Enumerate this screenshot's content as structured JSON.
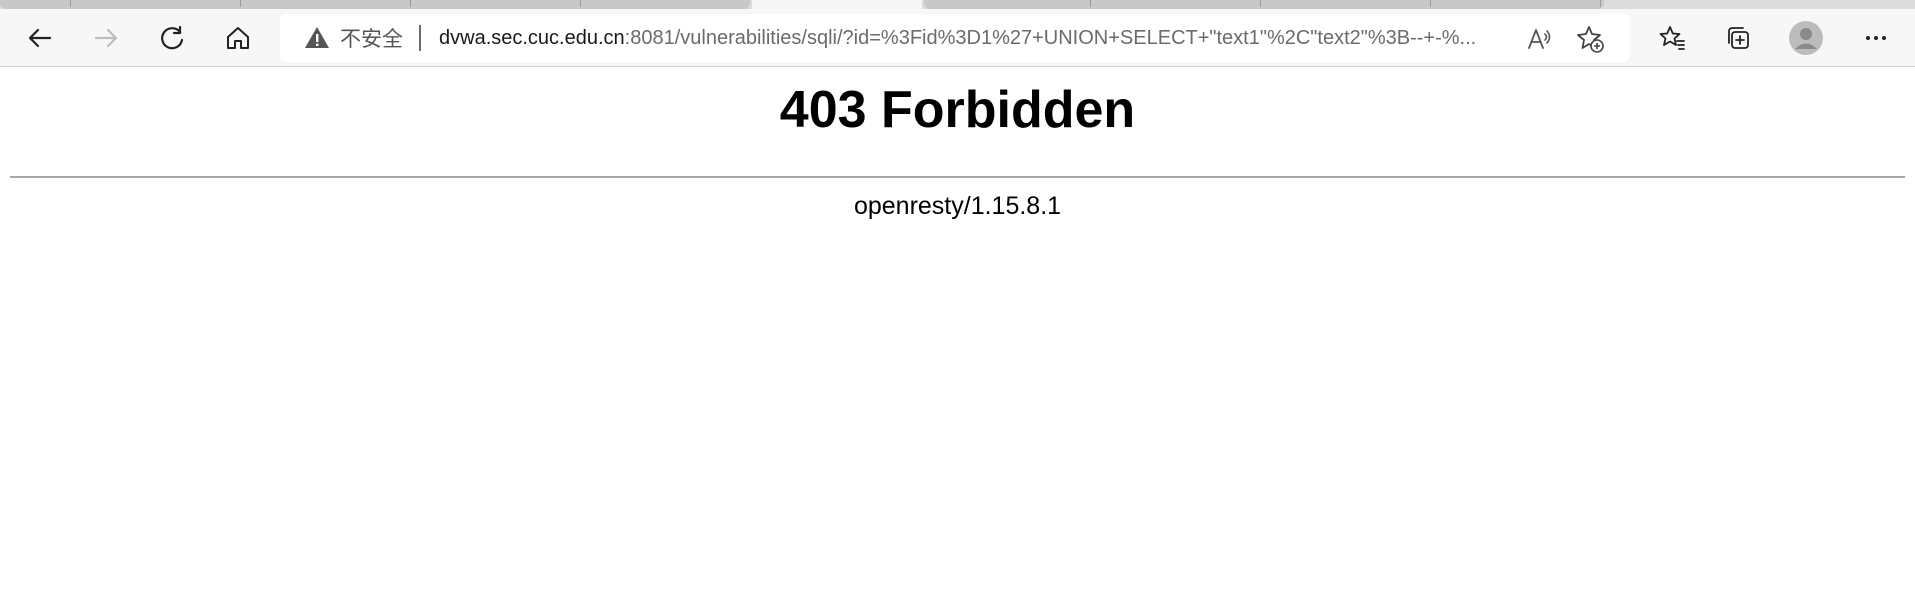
{
  "browser": {
    "security_label": "不安全",
    "url_host": "dvwa.sec.cuc.edu.cn",
    "url_rest": ":8081/vulnerabilities/sqli/?id=%3Fid%3D1%27+UNION+SELECT+\"text1\"%2C\"text2\"%3B--+-%...",
    "icons": [
      "back-icon",
      "forward-icon",
      "refresh-icon",
      "home-icon",
      "warning-icon",
      "read-aloud-icon",
      "add-favorite-icon",
      "favorites-icon",
      "collections-icon",
      "profile-icon",
      "more-icon"
    ]
  },
  "page": {
    "title": "403 Forbidden",
    "server": "openresty/1.15.8.1"
  }
}
